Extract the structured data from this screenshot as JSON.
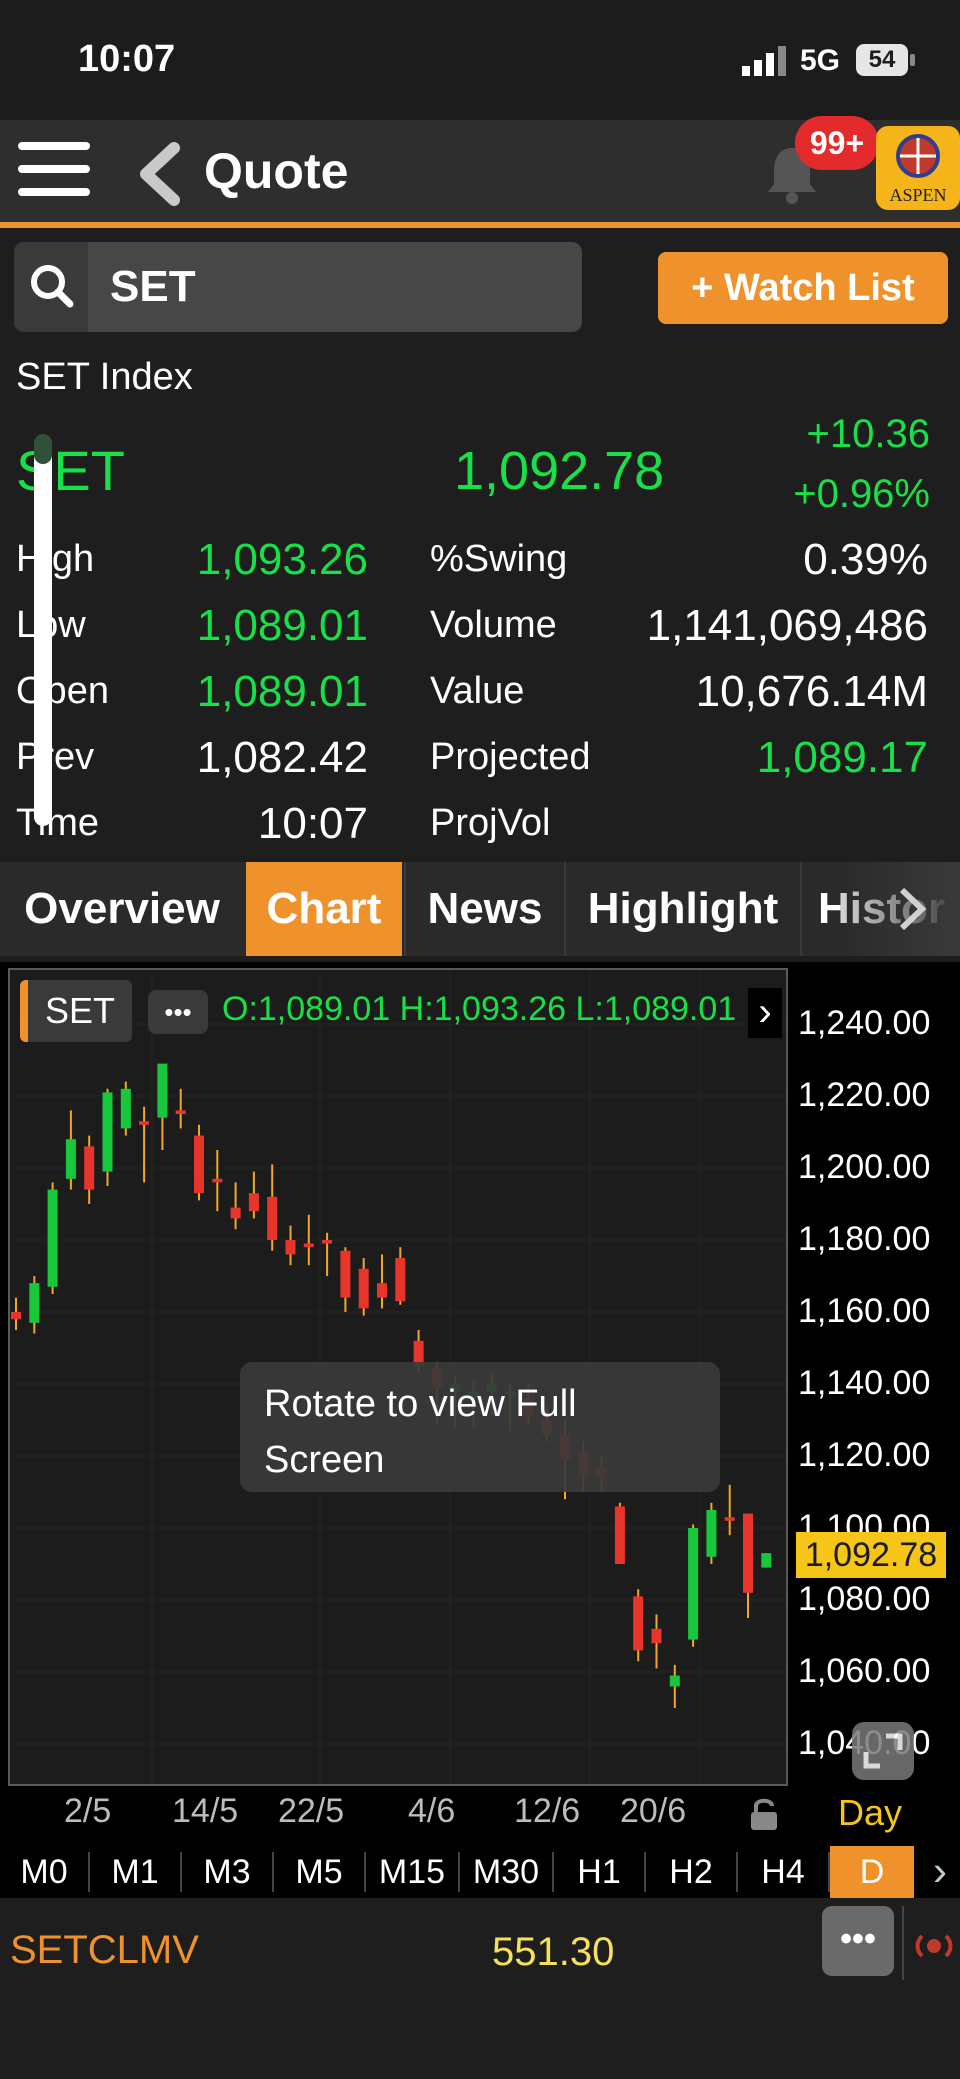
{
  "status": {
    "time": "10:07",
    "network": "5G",
    "battery": "54"
  },
  "nav": {
    "title": "Quote",
    "badge": "99+",
    "logo_text": "ASPEN"
  },
  "search": {
    "value": "SET"
  },
  "watch_list_label": "+ Watch List",
  "quote": {
    "index_name": "SET Index",
    "symbol": "SET",
    "last": "1,092.78",
    "change": "+10.36",
    "change_pct": "+0.96%",
    "rows": [
      {
        "label": "High",
        "value": "1,093.26",
        "label2": "%Swing",
        "value2": "0.39%"
      },
      {
        "label": "Low",
        "value": "1,089.01",
        "label2": "Volume",
        "value2": "1,141,069,486"
      },
      {
        "label": "Open",
        "value": "1,089.01",
        "label2": "Value",
        "value2": "10,676.14M"
      },
      {
        "label": "Prev",
        "value": "1,082.42",
        "label2": "Projected",
        "value2": "1,089.17"
      },
      {
        "label": "Time",
        "value": "10:07",
        "label2": "ProjVol",
        "value2": ""
      }
    ]
  },
  "tabs": [
    "Overview",
    "Chart",
    "News",
    "Highlight",
    "Histor"
  ],
  "chart": {
    "symbol_tag": "SET",
    "dots": "•••",
    "ohlc_text": "O:1,089.01  H:1,093.26  L:1,089.01",
    "price_ticks": [
      "1,240.00",
      "1,220.00",
      "1,200.00",
      "1,180.00",
      "1,160.00",
      "1,140.00",
      "1,120.00",
      "1,100.00",
      "1,080.00",
      "1,060.00",
      "1,040.00"
    ],
    "current_price": "1,092.78",
    "toast": "Rotate to view Full Screen",
    "dates": [
      "2/5",
      "14/5",
      "22/5",
      "4/6",
      "12/6",
      "20/6"
    ],
    "timeframe_label": "Day",
    "colors": {
      "up": "#17c83c",
      "down": "#e8352b",
      "wick": "#f5a623",
      "doji": "#f5a623"
    }
  },
  "chart_data": {
    "type": "candlestick",
    "ylim": [
      1040,
      1250
    ],
    "candles": [
      {
        "o": 1160,
        "h": 1164,
        "l": 1155,
        "c": 1158
      },
      {
        "o": 1157,
        "h": 1170,
        "l": 1154,
        "c": 1168
      },
      {
        "o": 1167,
        "h": 1196,
        "l": 1165,
        "c": 1194
      },
      {
        "o": 1197,
        "h": 1216,
        "l": 1194,
        "c": 1208
      },
      {
        "o": 1206,
        "h": 1209,
        "l": 1190,
        "c": 1194
      },
      {
        "o": 1199,
        "h": 1222,
        "l": 1195,
        "c": 1221
      },
      {
        "o": 1211,
        "h": 1224,
        "l": 1209,
        "c": 1222
      },
      {
        "o": 1213,
        "h": 1217,
        "l": 1196,
        "c": 1212
      },
      {
        "o": 1214,
        "h": 1226,
        "l": 1205,
        "c": 1229
      },
      {
        "o": 1216,
        "h": 1222,
        "l": 1211,
        "c": 1215
      },
      {
        "o": 1209,
        "h": 1212,
        "l": 1191,
        "c": 1193
      },
      {
        "o": 1197,
        "h": 1205,
        "l": 1188,
        "c": 1196
      },
      {
        "o": 1189,
        "h": 1196,
        "l": 1183,
        "c": 1186
      },
      {
        "o": 1193,
        "h": 1199,
        "l": 1186,
        "c": 1188
      },
      {
        "o": 1192,
        "h": 1201,
        "l": 1177,
        "c": 1180
      },
      {
        "o": 1180,
        "h": 1184,
        "l": 1173,
        "c": 1176
      },
      {
        "o": 1179,
        "h": 1187,
        "l": 1173,
        "c": 1178
      },
      {
        "o": 1180,
        "h": 1182,
        "l": 1170,
        "c": 1179
      },
      {
        "o": 1177,
        "h": 1178,
        "l": 1160,
        "c": 1164
      },
      {
        "o": 1172,
        "h": 1175,
        "l": 1159,
        "c": 1161
      },
      {
        "o": 1168,
        "h": 1176,
        "l": 1161,
        "c": 1164
      },
      {
        "o": 1175,
        "h": 1178,
        "l": 1162,
        "c": 1163
      },
      {
        "o": 1152,
        "h": 1155,
        "l": 1143,
        "c": 1145
      },
      {
        "o": 1144,
        "h": 1146,
        "l": 1129,
        "c": 1139
      },
      {
        "o": 1138,
        "h": 1142,
        "l": 1128,
        "c": 1140
      },
      {
        "o": 1136,
        "h": 1141,
        "l": 1128,
        "c": 1138
      },
      {
        "o": 1138,
        "h": 1143,
        "l": 1131,
        "c": 1140
      },
      {
        "o": 1137,
        "h": 1140,
        "l": 1127,
        "c": 1138
      },
      {
        "o": 1136,
        "h": 1140,
        "l": 1129,
        "c": 1131
      },
      {
        "o": 1130,
        "h": 1134,
        "l": 1124,
        "c": 1126
      },
      {
        "o": 1126,
        "h": 1130,
        "l": 1108,
        "c": 1119
      },
      {
        "o": 1121,
        "h": 1124,
        "l": 1110,
        "c": 1115
      },
      {
        "o": 1117,
        "h": 1120,
        "l": 1110,
        "c": 1114
      },
      {
        "o": 1106,
        "h": 1107,
        "l": 1090,
        "c": 1090
      },
      {
        "o": 1081,
        "h": 1083,
        "l": 1063,
        "c": 1066
      },
      {
        "o": 1072,
        "h": 1076,
        "l": 1061,
        "c": 1068
      },
      {
        "o": 1056,
        "h": 1062,
        "l": 1050,
        "c": 1059
      },
      {
        "o": 1069,
        "h": 1101,
        "l": 1067,
        "c": 1100
      },
      {
        "o": 1092,
        "h": 1107,
        "l": 1090,
        "c": 1105
      },
      {
        "o": 1103,
        "h": 1112,
        "l": 1098,
        "c": 1102
      },
      {
        "o": 1104,
        "h": 1104,
        "l": 1075,
        "c": 1082
      },
      {
        "o": 1089,
        "h": 1093,
        "l": 1089,
        "c": 1093
      }
    ]
  },
  "timeframes": [
    "M0",
    "M1",
    "M3",
    "M5",
    "M15",
    "M30",
    "H1",
    "H2",
    "H4",
    "D"
  ],
  "ticker": {
    "symbol": "SETCLMV",
    "value": "551.30",
    "more": "•••"
  }
}
